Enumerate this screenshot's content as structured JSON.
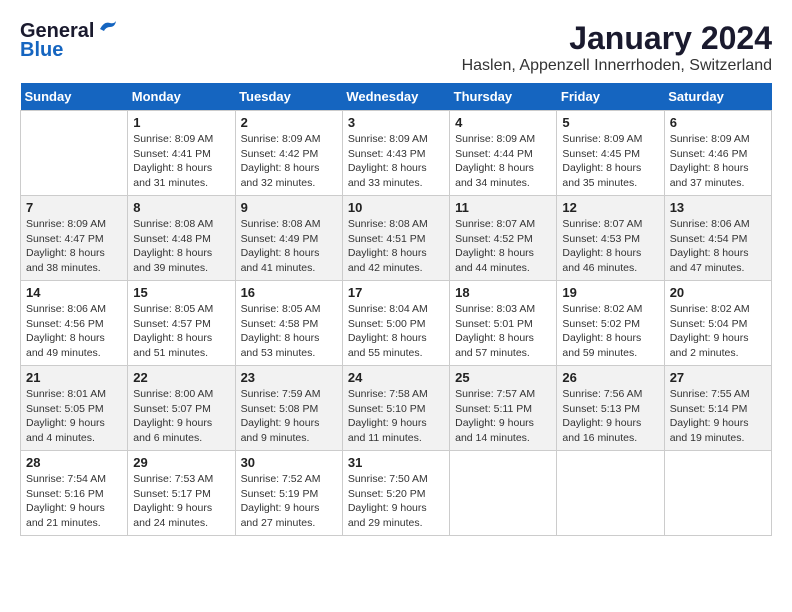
{
  "header": {
    "logo_general": "General",
    "logo_blue": "Blue",
    "month_year": "January 2024",
    "location": "Haslen, Appenzell Innerrhoden, Switzerland"
  },
  "days_of_week": [
    "Sunday",
    "Monday",
    "Tuesday",
    "Wednesday",
    "Thursday",
    "Friday",
    "Saturday"
  ],
  "weeks": [
    [
      {
        "day": "",
        "info": ""
      },
      {
        "day": "1",
        "info": "Sunrise: 8:09 AM\nSunset: 4:41 PM\nDaylight: 8 hours\nand 31 minutes."
      },
      {
        "day": "2",
        "info": "Sunrise: 8:09 AM\nSunset: 4:42 PM\nDaylight: 8 hours\nand 32 minutes."
      },
      {
        "day": "3",
        "info": "Sunrise: 8:09 AM\nSunset: 4:43 PM\nDaylight: 8 hours\nand 33 minutes."
      },
      {
        "day": "4",
        "info": "Sunrise: 8:09 AM\nSunset: 4:44 PM\nDaylight: 8 hours\nand 34 minutes."
      },
      {
        "day": "5",
        "info": "Sunrise: 8:09 AM\nSunset: 4:45 PM\nDaylight: 8 hours\nand 35 minutes."
      },
      {
        "day": "6",
        "info": "Sunrise: 8:09 AM\nSunset: 4:46 PM\nDaylight: 8 hours\nand 37 minutes."
      }
    ],
    [
      {
        "day": "7",
        "info": "Sunrise: 8:09 AM\nSunset: 4:47 PM\nDaylight: 8 hours\nand 38 minutes."
      },
      {
        "day": "8",
        "info": "Sunrise: 8:08 AM\nSunset: 4:48 PM\nDaylight: 8 hours\nand 39 minutes."
      },
      {
        "day": "9",
        "info": "Sunrise: 8:08 AM\nSunset: 4:49 PM\nDaylight: 8 hours\nand 41 minutes."
      },
      {
        "day": "10",
        "info": "Sunrise: 8:08 AM\nSunset: 4:51 PM\nDaylight: 8 hours\nand 42 minutes."
      },
      {
        "day": "11",
        "info": "Sunrise: 8:07 AM\nSunset: 4:52 PM\nDaylight: 8 hours\nand 44 minutes."
      },
      {
        "day": "12",
        "info": "Sunrise: 8:07 AM\nSunset: 4:53 PM\nDaylight: 8 hours\nand 46 minutes."
      },
      {
        "day": "13",
        "info": "Sunrise: 8:06 AM\nSunset: 4:54 PM\nDaylight: 8 hours\nand 47 minutes."
      }
    ],
    [
      {
        "day": "14",
        "info": "Sunrise: 8:06 AM\nSunset: 4:56 PM\nDaylight: 8 hours\nand 49 minutes."
      },
      {
        "day": "15",
        "info": "Sunrise: 8:05 AM\nSunset: 4:57 PM\nDaylight: 8 hours\nand 51 minutes."
      },
      {
        "day": "16",
        "info": "Sunrise: 8:05 AM\nSunset: 4:58 PM\nDaylight: 8 hours\nand 53 minutes."
      },
      {
        "day": "17",
        "info": "Sunrise: 8:04 AM\nSunset: 5:00 PM\nDaylight: 8 hours\nand 55 minutes."
      },
      {
        "day": "18",
        "info": "Sunrise: 8:03 AM\nSunset: 5:01 PM\nDaylight: 8 hours\nand 57 minutes."
      },
      {
        "day": "19",
        "info": "Sunrise: 8:02 AM\nSunset: 5:02 PM\nDaylight: 8 hours\nand 59 minutes."
      },
      {
        "day": "20",
        "info": "Sunrise: 8:02 AM\nSunset: 5:04 PM\nDaylight: 9 hours\nand 2 minutes."
      }
    ],
    [
      {
        "day": "21",
        "info": "Sunrise: 8:01 AM\nSunset: 5:05 PM\nDaylight: 9 hours\nand 4 minutes."
      },
      {
        "day": "22",
        "info": "Sunrise: 8:00 AM\nSunset: 5:07 PM\nDaylight: 9 hours\nand 6 minutes."
      },
      {
        "day": "23",
        "info": "Sunrise: 7:59 AM\nSunset: 5:08 PM\nDaylight: 9 hours\nand 9 minutes."
      },
      {
        "day": "24",
        "info": "Sunrise: 7:58 AM\nSunset: 5:10 PM\nDaylight: 9 hours\nand 11 minutes."
      },
      {
        "day": "25",
        "info": "Sunrise: 7:57 AM\nSunset: 5:11 PM\nDaylight: 9 hours\nand 14 minutes."
      },
      {
        "day": "26",
        "info": "Sunrise: 7:56 AM\nSunset: 5:13 PM\nDaylight: 9 hours\nand 16 minutes."
      },
      {
        "day": "27",
        "info": "Sunrise: 7:55 AM\nSunset: 5:14 PM\nDaylight: 9 hours\nand 19 minutes."
      }
    ],
    [
      {
        "day": "28",
        "info": "Sunrise: 7:54 AM\nSunset: 5:16 PM\nDaylight: 9 hours\nand 21 minutes."
      },
      {
        "day": "29",
        "info": "Sunrise: 7:53 AM\nSunset: 5:17 PM\nDaylight: 9 hours\nand 24 minutes."
      },
      {
        "day": "30",
        "info": "Sunrise: 7:52 AM\nSunset: 5:19 PM\nDaylight: 9 hours\nand 27 minutes."
      },
      {
        "day": "31",
        "info": "Sunrise: 7:50 AM\nSunset: 5:20 PM\nDaylight: 9 hours\nand 29 minutes."
      },
      {
        "day": "",
        "info": ""
      },
      {
        "day": "",
        "info": ""
      },
      {
        "day": "",
        "info": ""
      }
    ]
  ]
}
